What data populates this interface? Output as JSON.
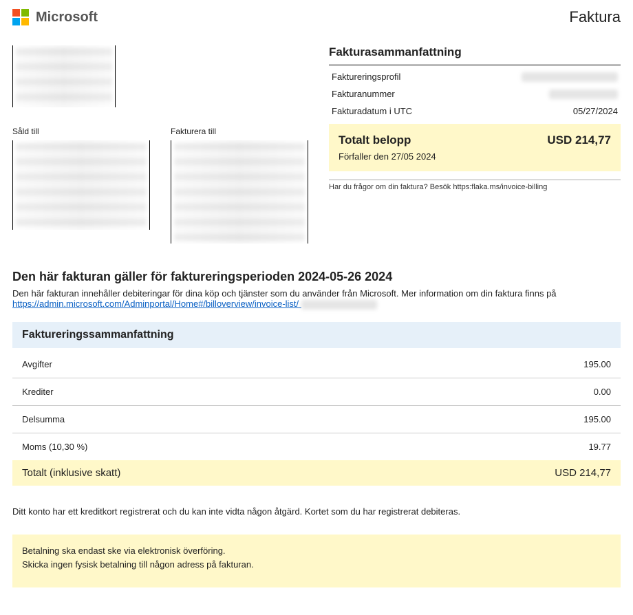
{
  "header": {
    "brand": "Microsoft",
    "doc_title": "Faktura"
  },
  "left": {
    "sold_to_label": "Såld till",
    "bill_to_label": "Fakturera till"
  },
  "summary_box": {
    "title": "Fakturasammanfattning",
    "profile_label": "Faktureringsprofil",
    "number_label": "Fakturanummer",
    "date_label": "Fakturadatum i UTC",
    "date_value": "05/27/2024",
    "total_label": "Totalt belopp",
    "total_value": "USD 214,77",
    "due_text": "Förfaller den 27/05 2024",
    "footnote": "Har du frågor om din faktura? Besök https:flaka.ms/invoice-billing"
  },
  "period": {
    "heading": "Den här fakturan gäller för faktureringsperioden 2024-05-26 2024",
    "desc": "Den här fakturan innehåller debiteringar för dina köp och tjänster som du använder från Microsoft. Mer information om din faktura finns på",
    "link_text": "https://admin.microsoft.com/Adminportal/Home#/billoverview/invoice-list/"
  },
  "billing_summary": {
    "bar_title": "Faktureringssammanfattning",
    "rows": [
      {
        "label": "Avgifter",
        "amount": "195.00"
      },
      {
        "label": "Krediter",
        "amount": "0.00"
      },
      {
        "label": "Delsumma",
        "amount": "195.00"
      },
      {
        "label": "Moms (10,30 %)",
        "amount": "19.77"
      }
    ],
    "grand_label": "Totalt (inklusive skatt)",
    "grand_amount": "USD 214,77"
  },
  "cc_note": "Ditt konto har ett kreditkort registrerat och du kan inte vidta någon åtgärd. Kortet som du har registrerat debiteras.",
  "payment_box": {
    "line1": "Betalning ska endast ske via elektronisk överföring.",
    "line2": "Skicka ingen fysisk betalning till någon adress på fakturan."
  }
}
